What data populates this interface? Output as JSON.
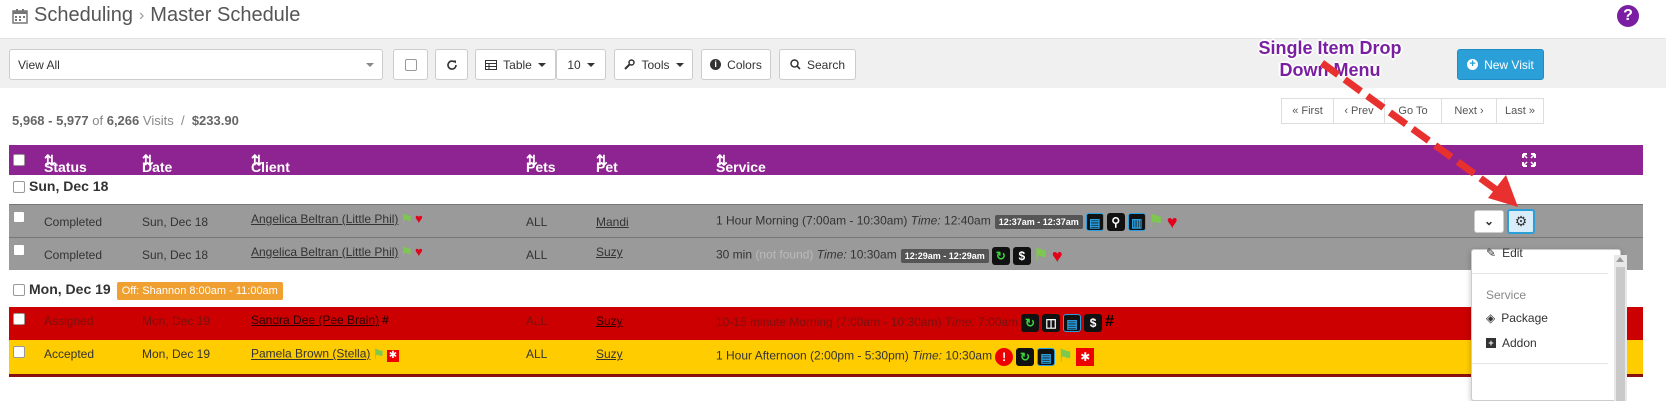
{
  "header": {
    "crumb1": "Scheduling",
    "crumb2": "Master Schedule",
    "sep": "›",
    "help": "?"
  },
  "toolbar": {
    "filter_value": "View All",
    "table_label": "Table",
    "page_size": "10",
    "tools_label": "Tools",
    "colors_label": "Colors",
    "search_label": "Search",
    "new_visit_label": "New Visit"
  },
  "summary": {
    "range": "5,968 - 5,977",
    "of": "of",
    "total": "6,266",
    "visits": "Visits",
    "slash": "/",
    "amount": "$233.90"
  },
  "pager": {
    "first": "« First",
    "prev": "‹ Prev",
    "goto": "Go To",
    "next": "Next ›",
    "last": "Last »"
  },
  "columns": {
    "status": "Status",
    "date": "Date",
    "client": "Client",
    "pets": "Pets",
    "sitter": "Pet Sitter",
    "service": "Service"
  },
  "groups": [
    {
      "label": "Sun, Dec 18",
      "off": ""
    },
    {
      "label": "Mon, Dec 19",
      "off": "Off: Shannon 8:00am - 11:00am"
    }
  ],
  "rows": [
    {
      "status": "Completed",
      "date": "Sun, Dec 18",
      "client": "Angelica Beltran (Little Phil)",
      "pets": "ALL",
      "sitter": "Mandi",
      "service": "1 Hour Morning (7:00am - 10:30am)",
      "time_label": "Time:",
      "time": "12:40am",
      "badge": "12:37am - 12:37am",
      "color": "#9a9a9a"
    },
    {
      "status": "Completed",
      "date": "Sun, Dec 18",
      "client": "Angelica Beltran (Little Phil)",
      "pets": "ALL",
      "sitter": "Suzy",
      "service": "30 min",
      "not_found": "(not found)",
      "time_label": "Time:",
      "time": "10:30am",
      "badge": "12:29am - 12:29am",
      "color": "#9a9a9a"
    },
    {
      "status": "Assigned",
      "date": "Mon, Dec 19",
      "client": "Sandra Dee (Pee Brain)",
      "pets": "ALL",
      "sitter": "Suzy",
      "service": "10-15 minute Morning (7:00am - 10:30am)",
      "time_label": "Time:",
      "time": "7:00am",
      "color": "#cc0000"
    },
    {
      "status": "Accepted",
      "date": "Mon, Dec 19",
      "client": "Pamela Brown (Stella)",
      "pets": "ALL",
      "sitter": "Suzy",
      "service": "1 Hour Afternoon (2:00pm - 5:30pm)",
      "time_label": "Time:",
      "time": "10:30am",
      "color": "#ffcc00"
    }
  ],
  "dropdown": {
    "edit": "Edit",
    "service_header": "Service",
    "package": "Package",
    "addon": "Addon"
  },
  "annotation": {
    "line1": "Single Item Drop",
    "line2": "Down Menu",
    "color": "#7a1fa2",
    "arrow_color": "#e8312f"
  },
  "icons": [
    "calendar-icon",
    "refresh-icon",
    "table-icon",
    "wrench-icon",
    "info-icon",
    "search-icon",
    "plus-icon",
    "expand-icon",
    "gear-icon",
    "chevron-down-icon",
    "edit-icon",
    "package-icon",
    "plus-square-icon",
    "heart-icon",
    "flag-icon",
    "document-icon",
    "map-pin-icon",
    "dollar-icon",
    "fence-icon",
    "alert-icon"
  ]
}
